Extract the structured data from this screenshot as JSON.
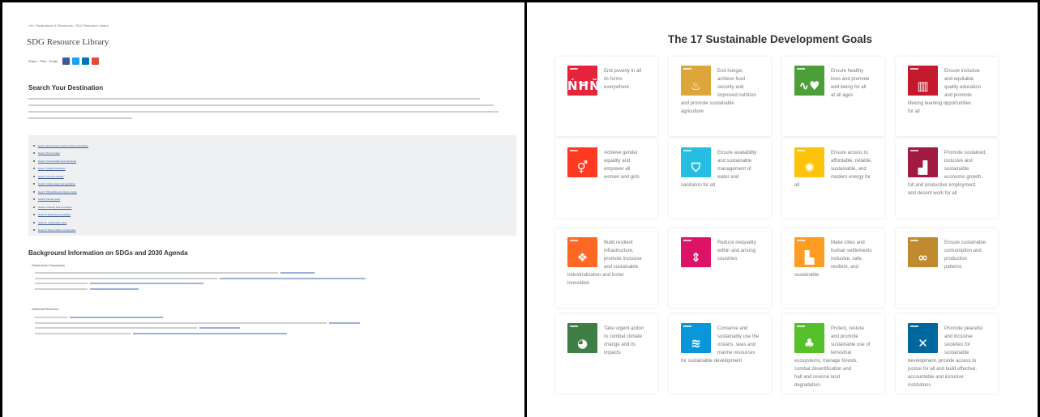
{
  "left_page": {
    "breadcrumb": "UN › Publications & Resources › SDG Resource Library",
    "library_title": "SDG Resource Library",
    "share_meta": "Share · Print · Email",
    "share_colors": [
      "#3b5998",
      "#1da1f2",
      "#0077b5",
      "#dd4b39"
    ],
    "section_search": "Search Your Destination",
    "goal_links": [
      "Goal 1: End poverty in all its forms everywhere",
      "Goal 2: Zero hunger",
      "Goal 3: Good health and well-being",
      "Goal 4: Quality education",
      "Goal 5: Gender equality",
      "Goal 6: Clean water and sanitation",
      "Goal 7: Affordable and clean energy",
      "Goal 8: Decent work",
      "Goal 9: Industry and innovation",
      "Goal 10: Reduced inequalities",
      "Goal 11: Sustainable cities",
      "Goal 12: Responsible consumption"
    ],
    "section_background": "Background Information on SDGs and 2030 Agenda",
    "bg_sub1": "Global Action Frameworks",
    "bg_sub2": "Additional Resources"
  },
  "right_page": {
    "title": "The 17 Sustainable Development Goals",
    "goals": [
      {
        "color": "#e5243b",
        "glyph": "ŃĦŇ",
        "lines": [
          "End poverty in all",
          "its forms",
          "everywhere"
        ],
        "more": []
      },
      {
        "color": "#dda63a",
        "glyph": "♨",
        "lines": [
          "End hunger,",
          "achieve food",
          "security and",
          "improved nutrition"
        ],
        "more": [
          "and promote sustainable",
          "agriculture"
        ]
      },
      {
        "color": "#4c9f38",
        "glyph": "∿♥",
        "lines": [
          "Ensure healthy",
          "lives and promote",
          "well-being for all",
          "at all ages"
        ],
        "more": []
      },
      {
        "color": "#c5192d",
        "glyph": "▥",
        "lines": [
          "Ensure inclusive",
          "and equitable",
          "quality education",
          "and promote"
        ],
        "more": [
          "lifelong learning opportunities",
          "for all"
        ]
      },
      {
        "color": "#ff3a21",
        "glyph": "⚥",
        "lines": [
          "Achieve gender",
          "equality and",
          "empower all",
          "women and girls"
        ],
        "more": []
      },
      {
        "color": "#26bde2",
        "glyph": "⛉",
        "lines": [
          "Ensure availability",
          "and sustainable",
          "management of",
          "water and"
        ],
        "more": [
          "sanitation for all"
        ]
      },
      {
        "color": "#fcc30b",
        "glyph": "✺",
        "lines": [
          "Ensure access to",
          "affordable, reliable,",
          "sustainable, and",
          "modern energy for"
        ],
        "more": [
          "all"
        ]
      },
      {
        "color": "#a21942",
        "glyph": "▟",
        "lines": [
          "Promote sustained,",
          "inclusive and",
          "sustainable",
          "economic growth,"
        ],
        "more": [
          "full and productive employment,",
          "and decent work for all"
        ]
      },
      {
        "color": "#fd6925",
        "glyph": "❖",
        "lines": [
          "Build resilient",
          "infrastructure,",
          "promote inclusive",
          "and sustainable"
        ],
        "more": [
          "industrialization and foster",
          "innovation"
        ]
      },
      {
        "color": "#dd1367",
        "glyph": "⇕",
        "lines": [
          "Reduce inequality",
          "within and among",
          "countries"
        ],
        "more": []
      },
      {
        "color": "#fd9d24",
        "glyph": "▙",
        "lines": [
          "Make cities and",
          "human settlements",
          "inclusive, safe,",
          "resilient, and"
        ],
        "more": [
          "sustainable"
        ]
      },
      {
        "color": "#bf8b2e",
        "glyph": "∞",
        "lines": [
          "Ensure sustainable",
          "consumption and",
          "production",
          "patterns"
        ],
        "more": []
      },
      {
        "color": "#3f7e44",
        "glyph": "◕",
        "lines": [
          "Take urgent action",
          "to combat climate",
          "change and its",
          "impacts"
        ],
        "more": []
      },
      {
        "color": "#0a97d9",
        "glyph": "≋",
        "lines": [
          "Conserve and",
          "sustainably use the",
          "oceans, seas and",
          "marine resources"
        ],
        "more": [
          "for sustainable development"
        ]
      },
      {
        "color": "#56c02b",
        "glyph": "♣",
        "lines": [
          "Protect, restore",
          "and promote",
          "sustainable use of",
          "terrestrial"
        ],
        "more": [
          "ecosystems, manage forests,",
          "combat desertification and",
          "halt and reverse land",
          "degradation"
        ]
      },
      {
        "color": "#00689d",
        "glyph": "✕",
        "lines": [
          "Promote peaceful",
          "and inclusive",
          "societies for",
          "sustainable"
        ],
        "more": [
          "development, provide access to",
          "justice for all and build effective,",
          "accountable and inclusive",
          "institutions"
        ]
      }
    ]
  }
}
